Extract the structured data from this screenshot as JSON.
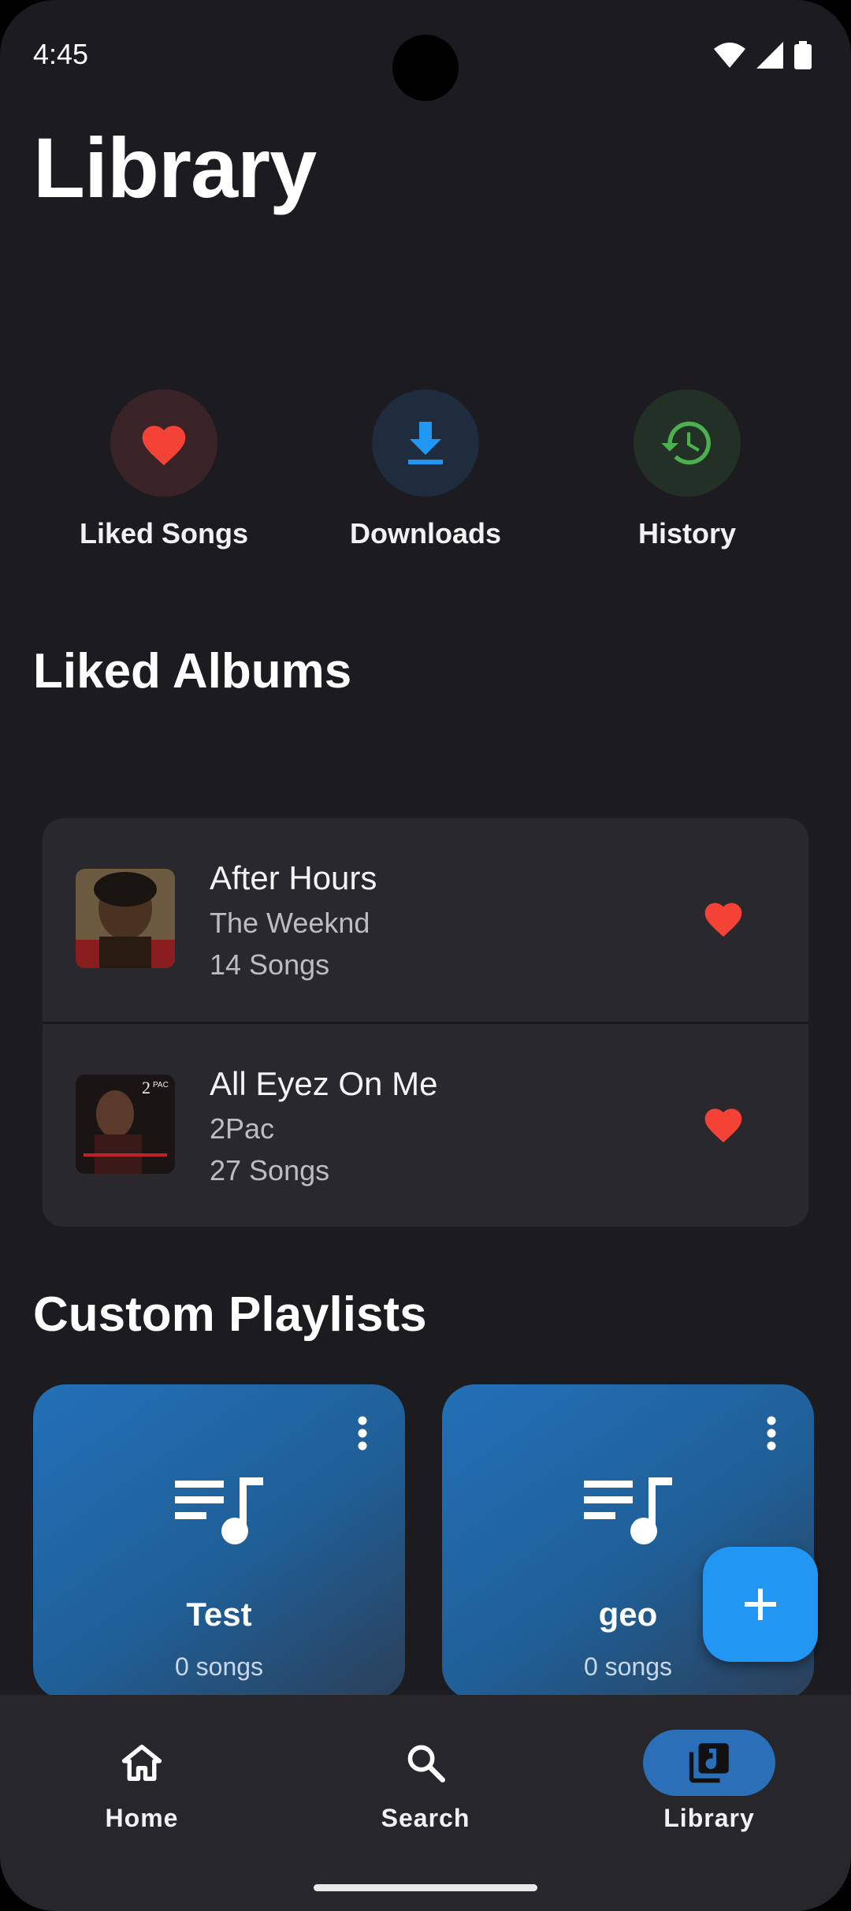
{
  "status_bar": {
    "time": "4:45"
  },
  "page": {
    "title": "Library"
  },
  "quick_actions": [
    {
      "label": "Liked Songs",
      "icon": "heart-icon",
      "color": "#f44336"
    },
    {
      "label": "Downloads",
      "icon": "download-icon",
      "color": "#2196f3"
    },
    {
      "label": "History",
      "icon": "history-icon",
      "color": "#4caf50"
    }
  ],
  "liked_albums": {
    "title": "Liked Albums",
    "items": [
      {
        "title": "After Hours",
        "artist": "The Weeknd",
        "count": "14 Songs"
      },
      {
        "title": "All Eyez On Me",
        "artist": "2Pac",
        "count": "27 Songs"
      }
    ]
  },
  "custom_playlists": {
    "title": "Custom Playlists",
    "items": [
      {
        "name": "Test",
        "count": "0 songs"
      },
      {
        "name": "geo",
        "count": "0 songs"
      }
    ]
  },
  "bottom_nav": {
    "items": [
      {
        "label": "Home",
        "icon": "home-icon"
      },
      {
        "label": "Search",
        "icon": "search-icon"
      },
      {
        "label": "Library",
        "icon": "library-icon",
        "active": true
      }
    ]
  },
  "colors": {
    "accent": "#2196f3",
    "background": "#1c1b20",
    "heart": "#f44336"
  }
}
